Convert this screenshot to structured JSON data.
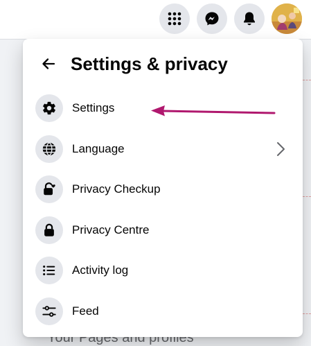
{
  "topbar": {
    "buttons": [
      {
        "icon": "menu-grid-icon"
      },
      {
        "icon": "messenger-icon"
      },
      {
        "icon": "bell-icon"
      }
    ],
    "avatar": "profile-avatar"
  },
  "background": {
    "partial_text": "Your Pages and profiles"
  },
  "panel": {
    "title": "Settings & privacy",
    "items": [
      {
        "label": "Settings",
        "icon": "gear-icon"
      },
      {
        "label": "Language",
        "icon": "globe-icon"
      },
      {
        "label": "Privacy Checkup",
        "icon": "lock-heart-icon"
      },
      {
        "label": "Privacy Centre",
        "icon": "lock-icon"
      },
      {
        "label": "Activity log",
        "icon": "list-icon"
      },
      {
        "label": "Feed",
        "icon": "sliders-icon"
      }
    ]
  },
  "colors": {
    "icon_bg": "#e4e6eb",
    "text": "#050505",
    "annotation_arrow": "#b0186e"
  }
}
